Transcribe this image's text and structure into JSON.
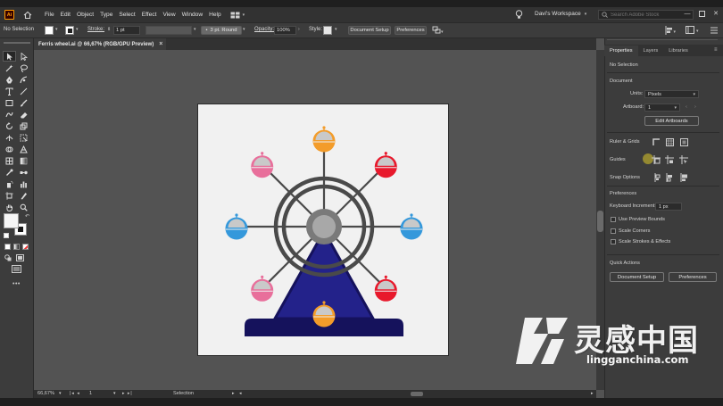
{
  "app": {
    "logo_text": "Ai"
  },
  "menu": [
    "File",
    "Edit",
    "Object",
    "Type",
    "Select",
    "Effect",
    "View",
    "Window",
    "Help"
  ],
  "workspace": {
    "label": "Davi's Workspace"
  },
  "search": {
    "placeholder": "Search Adobe Stock"
  },
  "control_bar": {
    "selection": "No Selection",
    "stroke_label": "Stroke:",
    "stroke_value": "1 pt",
    "brush_label": "3 pt. Round",
    "opacity_label": "Opacity:",
    "opacity_value": "100%",
    "style_label": "Style:",
    "document_setup": "Document Setup",
    "preferences": "Preferences"
  },
  "document_tab": {
    "title": "Ferris wheel.ai @ 66,67% (RGB/GPU Preview)",
    "close": "×"
  },
  "status_bar": {
    "zoom": "66,67%",
    "artboard_num": "1",
    "tool": "Selection"
  },
  "panel": {
    "tabs": [
      "Properties",
      "Layers",
      "Libraries"
    ],
    "selection": "No Selection",
    "document_header": "Document",
    "units_label": "Units:",
    "units_value": "Pixels",
    "artboard_label": "Artboard:",
    "artboard_value": "1",
    "edit_artboards": "Edit Artboards",
    "rulers_grids": "Ruler & Grids",
    "guides": "Guides",
    "snap_options": "Snap Options",
    "preferences_header": "Preferences",
    "keyboard_increment_label": "Keyboard Increment:",
    "keyboard_increment_value": "1 px",
    "use_preview_bounds": "Use Preview Bounds",
    "scale_corners": "Scale Corners",
    "scale_strokes": "Scale Strokes & Effects",
    "quick_actions": "Quick Actions",
    "document_setup": "Document Setup",
    "preferences": "Preferences"
  },
  "watermark": {
    "chinese": "灵感中国",
    "url": "lingganchina.com"
  },
  "colors": {
    "orange": "#f39c2a",
    "red": "#e8192c",
    "pink": "#e86f9b",
    "blue": "#3498db",
    "base_navy": "#15125c",
    "tower_blue": "#23228a",
    "wheel_gray": "#4a4a4a"
  }
}
